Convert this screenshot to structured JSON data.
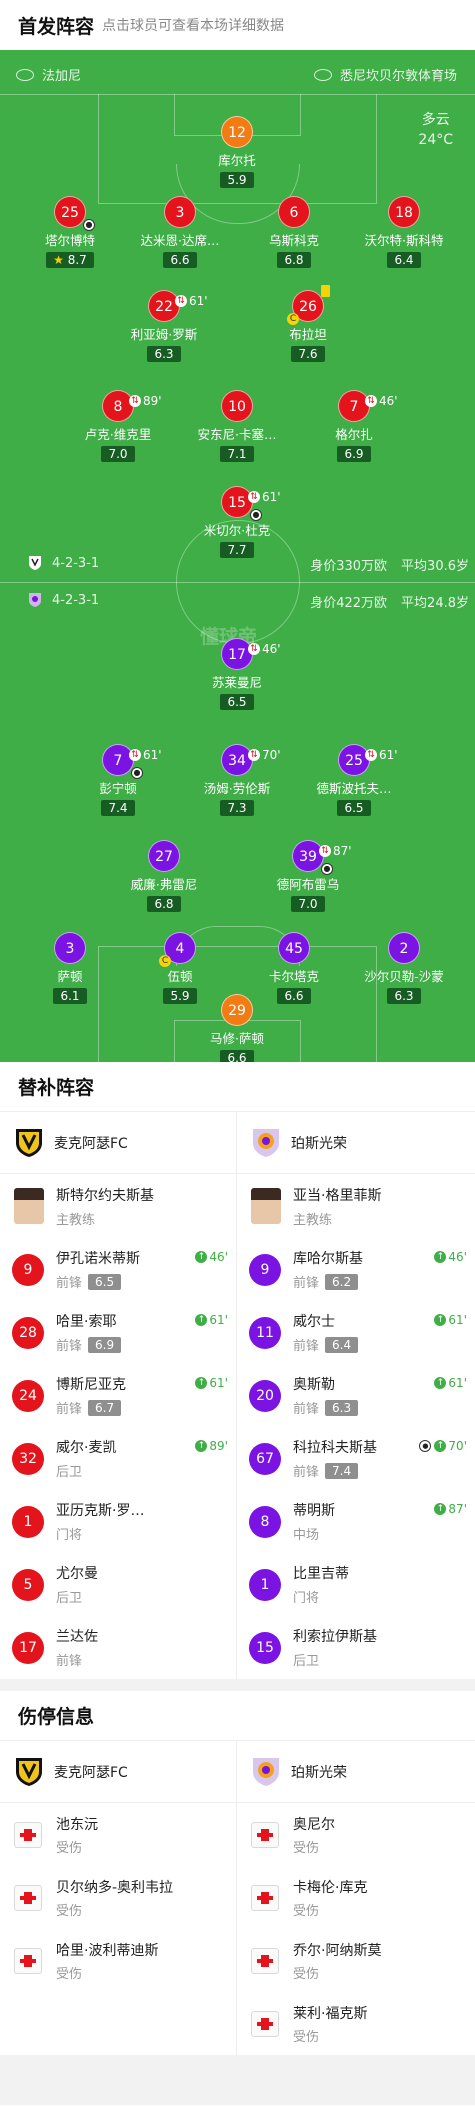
{
  "header": {
    "title": "首发阵容",
    "subtitle": "点击球员可查看本场详细数据"
  },
  "pitch": {
    "home_team": "法加尼",
    "venue": "悉尼坎贝尔敦体育场",
    "weather": "多云",
    "temperature": "24°C",
    "watermark": "懂球帝",
    "home_formation": "4-2-3-1",
    "home_value": "身价330万欧",
    "home_age": "平均30.6岁",
    "away_formation": "4-2-3-1",
    "away_value": "身价422万欧",
    "away_age": "平均24.8岁"
  },
  "home_players": [
    {
      "num": "12",
      "name": "库尔托",
      "rating": "5.9",
      "kind": "gk"
    },
    {
      "num": "25",
      "name": "塔尔博特",
      "rating": "8.7",
      "kind": "h",
      "star": "⭐"
    },
    {
      "num": "3",
      "name": "达米恩·达席…",
      "rating": "6.6",
      "kind": "h"
    },
    {
      "num": "6",
      "name": "乌斯科克",
      "rating": "6.8",
      "kind": "h"
    },
    {
      "num": "18",
      "name": "沃尔特·斯科特",
      "rating": "6.4",
      "kind": "h"
    },
    {
      "num": "22",
      "name": "利亚姆·罗斯",
      "rating": "6.3",
      "kind": "h",
      "sub": "61'"
    },
    {
      "num": "26",
      "name": "布拉坦",
      "rating": "7.6",
      "kind": "h"
    },
    {
      "num": "8",
      "name": "卢克·维克里",
      "rating": "7.0",
      "kind": "h",
      "sub": "89'"
    },
    {
      "num": "10",
      "name": "安东尼·卡塞…",
      "rating": "7.1",
      "kind": "h"
    },
    {
      "num": "7",
      "name": "格尔扎",
      "rating": "6.9",
      "kind": "h",
      "sub": "46'"
    },
    {
      "num": "15",
      "name": "米切尔·杜克",
      "rating": "7.7",
      "kind": "h",
      "sub": "61'"
    }
  ],
  "away_players": [
    {
      "num": "17",
      "name": "苏莱曼尼",
      "rating": "6.5",
      "kind": "a",
      "sub": "46'"
    },
    {
      "num": "7",
      "name": "彭宁顿",
      "rating": "7.4",
      "kind": "a",
      "sub": "61'"
    },
    {
      "num": "34",
      "name": "汤姆·劳伦斯",
      "rating": "7.3",
      "kind": "a",
      "sub": "70'"
    },
    {
      "num": "25",
      "name": "德斯波托夫…",
      "rating": "6.5",
      "kind": "a",
      "sub": "61'"
    },
    {
      "num": "27",
      "name": "威廉·弗雷尼",
      "rating": "6.8",
      "kind": "a"
    },
    {
      "num": "39",
      "name": "德阿布雷乌",
      "rating": "7.0",
      "kind": "a",
      "sub": "87'"
    },
    {
      "num": "3",
      "name": "萨顿",
      "rating": "6.1",
      "kind": "a"
    },
    {
      "num": "4",
      "name": "伍顿",
      "rating": "5.9",
      "kind": "a"
    },
    {
      "num": "45",
      "name": "卡尔塔克",
      "rating": "6.6",
      "kind": "a"
    },
    {
      "num": "2",
      "name": "沙尔贝勒-沙蒙",
      "rating": "6.3",
      "kind": "a"
    },
    {
      "num": "29",
      "name": "马修·萨顿",
      "rating": "6.6",
      "kind": "gk"
    }
  ],
  "subs_section_title": "替补阵容",
  "home_team_name": "麦克阿瑟FC",
  "away_team_name": "珀斯光荣",
  "home_coach": {
    "name": "斯特尔约夫斯基",
    "role": "主教练"
  },
  "away_coach": {
    "name": "亚当·格里菲斯",
    "role": "主教练"
  },
  "home_subs": [
    {
      "num": "9",
      "name": "伊孔诺米蒂斯",
      "pos": "前锋",
      "rating": "6.5",
      "event": "46'"
    },
    {
      "num": "28",
      "name": "哈里·索耶",
      "pos": "前锋",
      "rating": "6.9",
      "event": "61'"
    },
    {
      "num": "24",
      "name": "博斯尼亚克",
      "pos": "前锋",
      "rating": "6.7",
      "event": "61'"
    },
    {
      "num": "32",
      "name": "威尔·麦凯",
      "pos": "后卫",
      "rating": "",
      "event": "89'"
    },
    {
      "num": "1",
      "name": "亚历克斯·罗…",
      "pos": "门将",
      "rating": "",
      "event": ""
    },
    {
      "num": "5",
      "name": "尤尔曼",
      "pos": "后卫",
      "rating": "",
      "event": ""
    },
    {
      "num": "17",
      "name": "兰达佐",
      "pos": "前锋",
      "rating": "",
      "event": ""
    }
  ],
  "away_subs": [
    {
      "num": "9",
      "name": "库哈尔斯基",
      "pos": "前锋",
      "rating": "6.2",
      "event": "46'"
    },
    {
      "num": "11",
      "name": "威尔士",
      "pos": "前锋",
      "rating": "6.4",
      "event": "61'"
    },
    {
      "num": "20",
      "name": "奥斯勒",
      "pos": "前锋",
      "rating": "6.3",
      "event": "61'"
    },
    {
      "num": "67",
      "name": "科拉科夫斯基",
      "pos": "前锋",
      "rating": "7.4",
      "event": "70'"
    },
    {
      "num": "8",
      "name": "蒂明斯",
      "pos": "中场",
      "rating": "",
      "event": "87'"
    },
    {
      "num": "1",
      "name": "比里吉蒂",
      "pos": "门将",
      "rating": "",
      "event": ""
    },
    {
      "num": "15",
      "name": "利索拉伊斯基",
      "pos": "后卫",
      "rating": "",
      "event": ""
    }
  ],
  "injury_section_title": "伤停信息",
  "home_injuries": [
    {
      "name": "池东沅",
      "status": "受伤"
    },
    {
      "name": "贝尔纳多-奥利韦拉",
      "status": "受伤"
    },
    {
      "name": "哈里·波利蒂迪斯",
      "status": "受伤"
    }
  ],
  "away_injuries": [
    {
      "name": "奥尼尔",
      "status": "受伤"
    },
    {
      "name": "卡梅伦·库克",
      "status": "受伤"
    },
    {
      "name": "乔尔·阿纳斯莫",
      "status": "受伤"
    },
    {
      "name": "莱利·福克斯",
      "status": "受伤"
    }
  ],
  "colors": {
    "pitch": "#3fae47",
    "home": "#e3141c",
    "away": "#7b14e3",
    "gk": "#f27b13"
  }
}
